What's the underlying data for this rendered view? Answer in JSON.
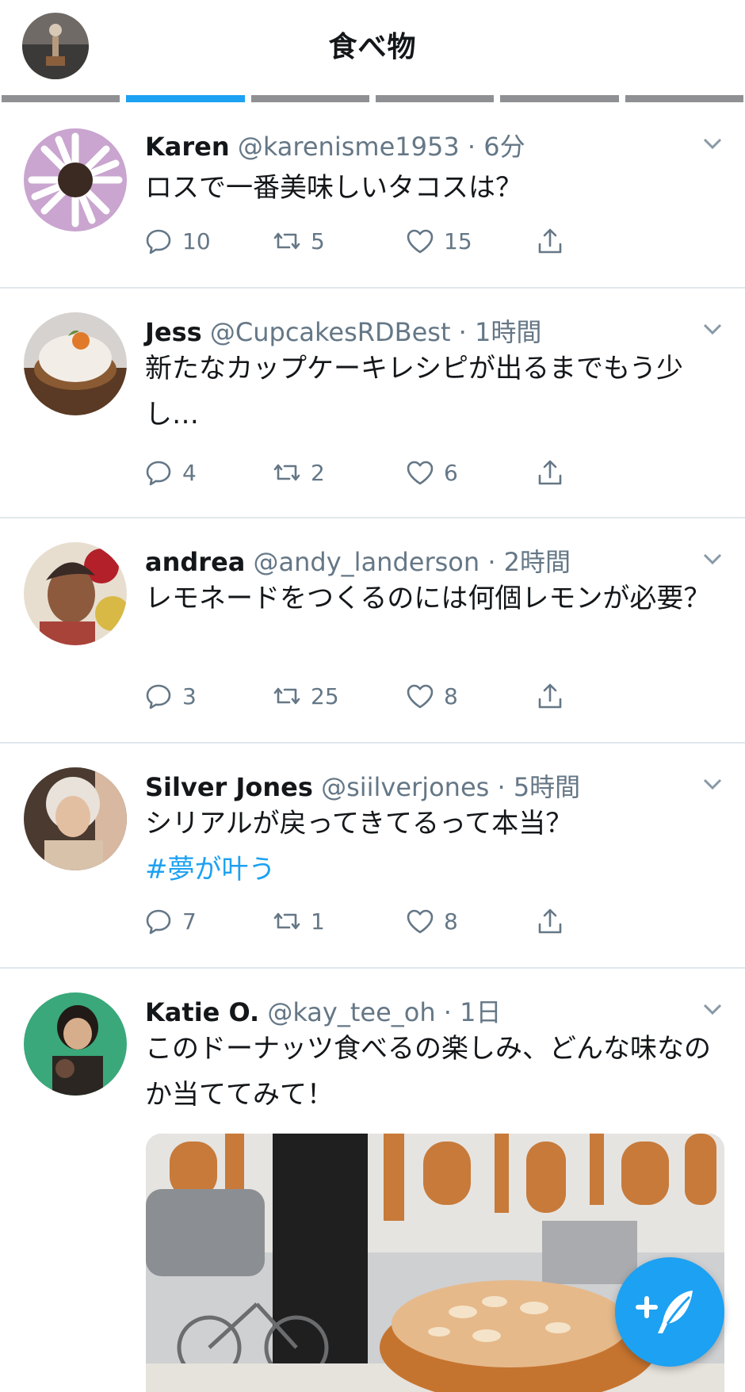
{
  "header": {
    "title": "食べ物",
    "progress_segments": 6,
    "active_segment": 1
  },
  "tweets": [
    {
      "name": "Karen",
      "handle": "@karenisme1953",
      "time": "· 6分",
      "text": "ロスで一番美味しいタコスは？",
      "hashtag": "",
      "replies": "10",
      "retweets": "5",
      "likes": "15"
    },
    {
      "name": "Jess",
      "handle": "@CupcakesRDBest",
      "time": "· 1時間",
      "text": "新たなカップケーキレシピが出るまでもう少し…",
      "hashtag": "",
      "replies": "4",
      "retweets": "2",
      "likes": "6"
    },
    {
      "name": "andrea",
      "handle": "@andy_landerson",
      "time": "· 2時間",
      "text": "レモネードをつくるのには何個レモンが必要？",
      "hashtag": "",
      "replies": "3",
      "retweets": "25",
      "likes": "8"
    },
    {
      "name": "Silver Jones",
      "handle": "@siilverjones",
      "time": "· 5時間",
      "text": "シリアルが戻ってきてるって本当？",
      "hashtag": "#夢が叶う",
      "replies": "7",
      "retweets": "1",
      "likes": "8"
    },
    {
      "name": "Katie O.",
      "handle": "@kay_tee_oh",
      "time": "· 1日",
      "text": "このドーナッツ食べるの楽しみ、どんな味なのか当ててみて！",
      "hashtag": ""
    }
  ],
  "icons": {
    "reply": "reply-icon",
    "retweet": "retweet-icon",
    "like": "heart-icon",
    "share": "share-icon",
    "more": "chevron-down-icon",
    "compose": "compose-tweet-icon"
  },
  "colors": {
    "accent": "#1da1f2",
    "text": "#14171a",
    "secondary": "#657786",
    "divider": "#e1e8ed"
  }
}
